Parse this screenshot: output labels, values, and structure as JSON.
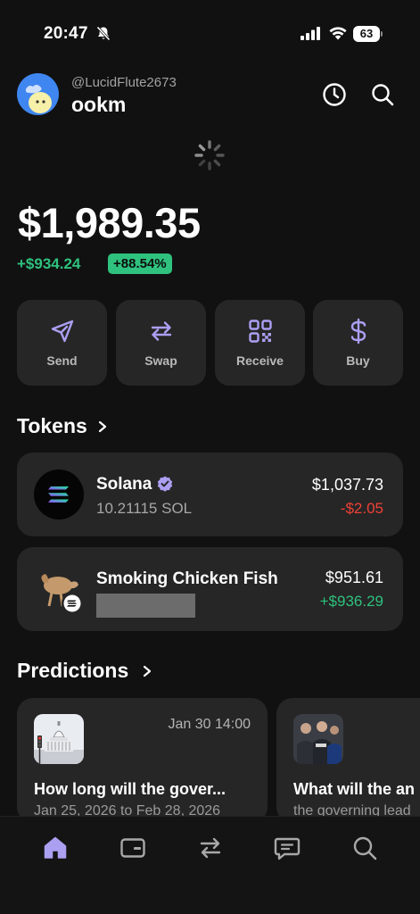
{
  "status_bar": {
    "time": "20:47",
    "battery": "63",
    "icons": [
      "silent-bell-icon",
      "cellular-signal-icon",
      "wifi-icon",
      "battery-icon"
    ]
  },
  "header": {
    "handle": "@LucidFlute2673",
    "username": "ookm",
    "icons": [
      "history-icon",
      "search-icon"
    ]
  },
  "portfolio": {
    "balance": "$1,989.35",
    "change": "+$934.24",
    "change_pct": "+88.54%"
  },
  "actions": [
    {
      "label": "Send",
      "icon": "send-icon"
    },
    {
      "label": "Swap",
      "icon": "swap-icon"
    },
    {
      "label": "Receive",
      "icon": "qr-code-icon"
    },
    {
      "label": "Buy",
      "icon": "dollar-icon"
    }
  ],
  "tokens_section": {
    "title": "Tokens",
    "items": [
      {
        "name": "Solana",
        "amount": "10.21115 SOL",
        "value": "$1,037.73",
        "change": "-$2.05",
        "verified": true
      },
      {
        "name": "Smoking Chicken Fish",
        "amount": "",
        "value": "$951.61",
        "change": "+$936.29",
        "verified": false
      }
    ]
  },
  "predictions_section": {
    "title": "Predictions",
    "items": [
      {
        "date": "Jan 30 14:00",
        "title": "How long will the gover...",
        "subtitle": "Jan 25, 2026 to Feb 28, 2026"
      },
      {
        "date": "",
        "title": "What will the an",
        "subtitle": "the governing lead"
      }
    ]
  },
  "tab_bar": {
    "tabs": [
      "home-icon",
      "wallet-icon",
      "swap-icon",
      "chat-icon",
      "search-icon"
    ]
  },
  "colors": {
    "background": "#111111",
    "card": "#262626",
    "accent": "#ab9ff2",
    "positive": "#2ec27e",
    "negative": "#ef4136"
  }
}
